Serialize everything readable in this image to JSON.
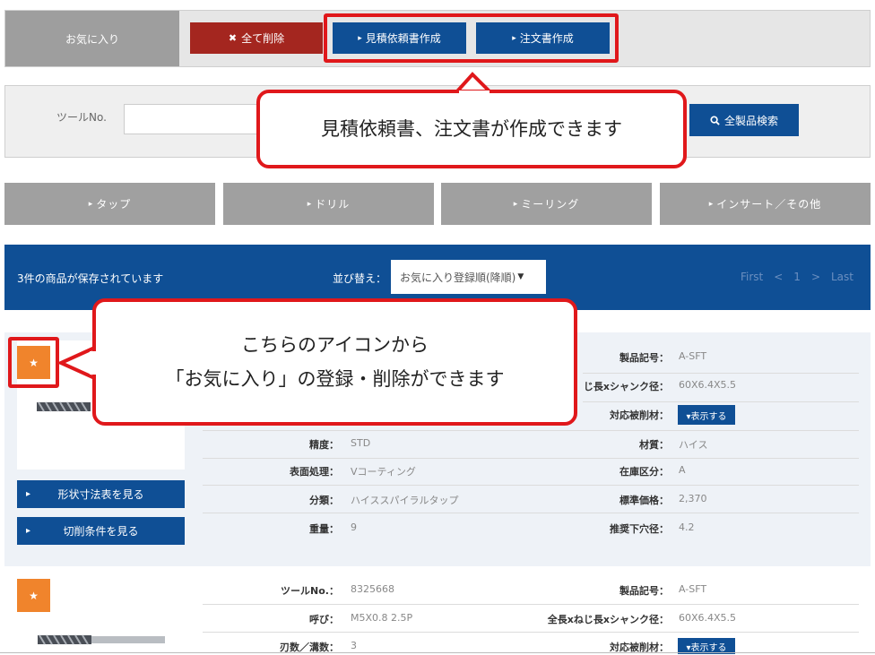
{
  "favorites": {
    "label": "お気に入り",
    "delete_all": "全て削除",
    "quote_button": "見積依頼書作成",
    "order_button": "注文書作成"
  },
  "search": {
    "tool_label": "ツールNo.",
    "tool_value": "",
    "search_button": "全製品検索"
  },
  "callouts": {
    "top": "見積依頼書、注文書が作成できます",
    "icon_line1": "こちらのアイコンから",
    "icon_line2": "「お気に入り」の登録・削除ができます"
  },
  "tabs": [
    "タップ",
    "ドリル",
    "ミーリング",
    "インサート／その他"
  ],
  "results": {
    "count_text": "3件の商品が保存されています",
    "sort_label": "並び替え：",
    "sort_value": "お気に入り登録順(降順)",
    "pager": [
      "First",
      "<",
      "1",
      ">",
      "Last"
    ]
  },
  "product1": {
    "shape_button": "形状寸法表を見る",
    "cutting_button": "切削条件を見る",
    "rows": {
      "product_code_key": "製品記号：",
      "product_code_val": "A-SFT",
      "length_key": "じ長xシャンク径：",
      "length_val": "60X6.4X5.5",
      "material_key": "対応被削材：",
      "show_button": "▾表示する",
      "precision_key": "精度：",
      "precision_val": "STD",
      "mat_key": "材質：",
      "mat_val": "ハイス",
      "surface_key": "表面処理：",
      "surface_val": "Vコーティング",
      "stock_key": "在庫区分：",
      "stock_val": "A",
      "class_key": "分類：",
      "class_val": "ハイススパイラルタップ",
      "price_key": "標準価格：",
      "price_val": "2,370",
      "weight_key": "重量：",
      "weight_val": "9",
      "hole_key": "推奨下穴径：",
      "hole_val": "4.2"
    }
  },
  "product2": {
    "tool_no_key": "ツールNo.：",
    "tool_no_val": "8325668",
    "product_code_key": "製品記号：",
    "product_code_val": "A-SFT",
    "call_key": "呼び：",
    "call_val": "M5X0.8 2.5P",
    "length_key": "全長xねじ長xシャンク径：",
    "length_val": "60X6.4X5.5",
    "flutes_key": "刃数／溝数：",
    "flutes_val": "3",
    "material_key": "対応被削材：",
    "show_button": "▾表示する"
  },
  "icons": {
    "star": "★",
    "times": "✖",
    "triangle": "▸",
    "search": "search-icon"
  },
  "colors": {
    "brand_blue": "#0f4f95",
    "delete_red": "#a4261f",
    "highlight_red": "#e0181b",
    "star_orange": "#f0842c"
  }
}
